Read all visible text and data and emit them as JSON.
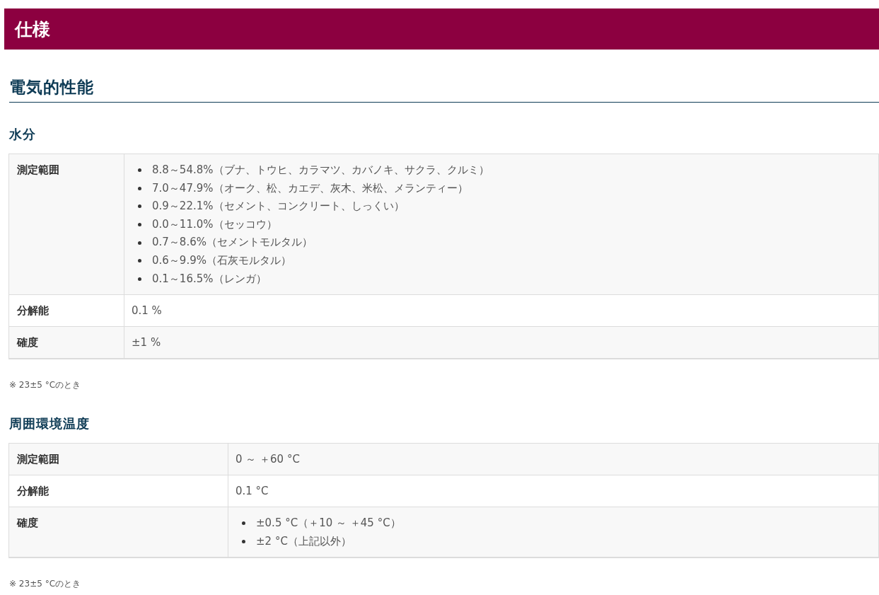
{
  "page_title": "仕様",
  "section": {
    "title": "電気的性能",
    "groups": [
      {
        "title": "水分",
        "rows": [
          {
            "label": "測定範囲",
            "kind": "list",
            "items": [
              "8.8～54.8%（ブナ、トウヒ、カラマツ、カバノキ、サクラ、クルミ）",
              "7.0～47.9%（オーク、松、カエデ、灰木、米松、メランティー）",
              "0.9～22.1%（セメント、コンクリート、しっくい）",
              "0.0～11.0%（セッコウ）",
              "0.7～8.6%（セメントモルタル）",
              "0.6～9.9%（石灰モルタル）",
              "0.1～16.5%（レンガ）"
            ]
          },
          {
            "label": "分解能",
            "kind": "text",
            "value": "0.1 %"
          },
          {
            "label": "確度",
            "kind": "text",
            "value": "±1 %"
          }
        ],
        "note": "※ 23±5 °Cのとき"
      },
      {
        "title": "周囲環境温度",
        "rows": [
          {
            "label": "測定範囲",
            "kind": "text",
            "value": "0 ～ ＋60 °C"
          },
          {
            "label": "分解能",
            "kind": "text",
            "value": "0.1 °C"
          },
          {
            "label": "確度",
            "kind": "list",
            "items": [
              "±0.5 °C（＋10 ～ ＋45 °C）",
              "±2 °C（上記以外）"
            ]
          }
        ],
        "note": "※ 23±5 °Cのとき"
      }
    ]
  }
}
